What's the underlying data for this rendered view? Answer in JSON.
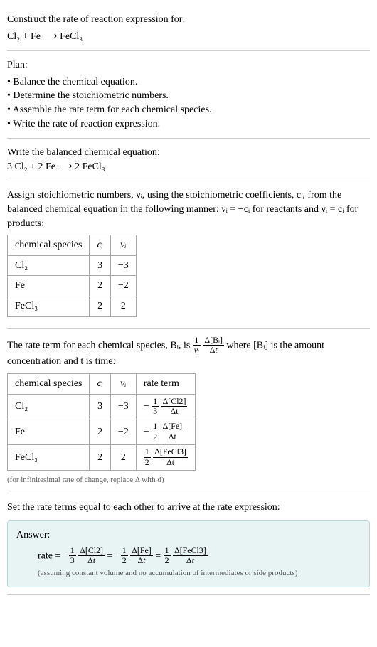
{
  "header": {
    "question": "Construct the rate of reaction expression for:",
    "equation_unbalanced": "Cl₂ + Fe ⟶ FeCl₃"
  },
  "plan": {
    "title": "Plan:",
    "steps": [
      "Balance the chemical equation.",
      "Determine the stoichiometric numbers.",
      "Assemble the rate term for each chemical species.",
      "Write the rate of reaction expression."
    ]
  },
  "balanced": {
    "intro": "Write the balanced chemical equation:",
    "equation": "3 Cl₂ + 2 Fe ⟶ 2 FeCl₃"
  },
  "stoich": {
    "intro": "Assign stoichiometric numbers, νᵢ, using the stoichiometric coefficients, cᵢ, from the balanced chemical equation in the following manner: νᵢ = −cᵢ for reactants and νᵢ = cᵢ for products:",
    "headers": [
      "chemical species",
      "cᵢ",
      "νᵢ"
    ],
    "rows": [
      {
        "species": "Cl₂",
        "c": "3",
        "nu": "−3"
      },
      {
        "species": "Fe",
        "c": "2",
        "nu": "−2"
      },
      {
        "species": "FeCl₃",
        "c": "2",
        "nu": "2"
      }
    ]
  },
  "rate_term": {
    "intro_a": "The rate term for each chemical species, Bᵢ, is ",
    "intro_b": " where [Bᵢ] is the amount concentration and t is time:",
    "headers": [
      "chemical species",
      "cᵢ",
      "νᵢ",
      "rate term"
    ],
    "rows": [
      {
        "species": "Cl₂",
        "c": "3",
        "nu": "−3",
        "rt_sign": "−",
        "rt_coef_num": "1",
        "rt_coef_den": "3",
        "rt_num": "Δ[Cl2]",
        "rt_den": "Δt"
      },
      {
        "species": "Fe",
        "c": "2",
        "nu": "−2",
        "rt_sign": "−",
        "rt_coef_num": "1",
        "rt_coef_den": "2",
        "rt_num": "Δ[Fe]",
        "rt_den": "Δt"
      },
      {
        "species": "FeCl₃",
        "c": "2",
        "nu": "2",
        "rt_sign": "",
        "rt_coef_num": "1",
        "rt_coef_den": "2",
        "rt_num": "Δ[FeCl3]",
        "rt_den": "Δt"
      }
    ],
    "note": "(for infinitesimal rate of change, replace Δ with d)"
  },
  "final": {
    "intro": "Set the rate terms equal to each other to arrive at the rate expression:",
    "answer_label": "Answer:",
    "rate_label": "rate = ",
    "assumption": "(assuming constant volume and no accumulation of intermediates or side products)"
  },
  "chart_data": {
    "type": "table",
    "tables": [
      {
        "title": "stoichiometric numbers",
        "columns": [
          "chemical species",
          "c_i",
          "nu_i"
        ],
        "rows": [
          [
            "Cl2",
            3,
            -3
          ],
          [
            "Fe",
            2,
            -2
          ],
          [
            "FeCl3",
            2,
            2
          ]
        ]
      },
      {
        "title": "rate terms",
        "columns": [
          "chemical species",
          "c_i",
          "nu_i",
          "rate term"
        ],
        "rows": [
          [
            "Cl2",
            3,
            -3,
            "-(1/3) d[Cl2]/dt"
          ],
          [
            "Fe",
            2,
            -2,
            "-(1/2) d[Fe]/dt"
          ],
          [
            "FeCl3",
            2,
            2,
            "(1/2) d[FeCl3]/dt"
          ]
        ]
      }
    ],
    "rate_expression": "rate = -(1/3) d[Cl2]/dt = -(1/2) d[Fe]/dt = (1/2) d[FeCl3]/dt"
  }
}
